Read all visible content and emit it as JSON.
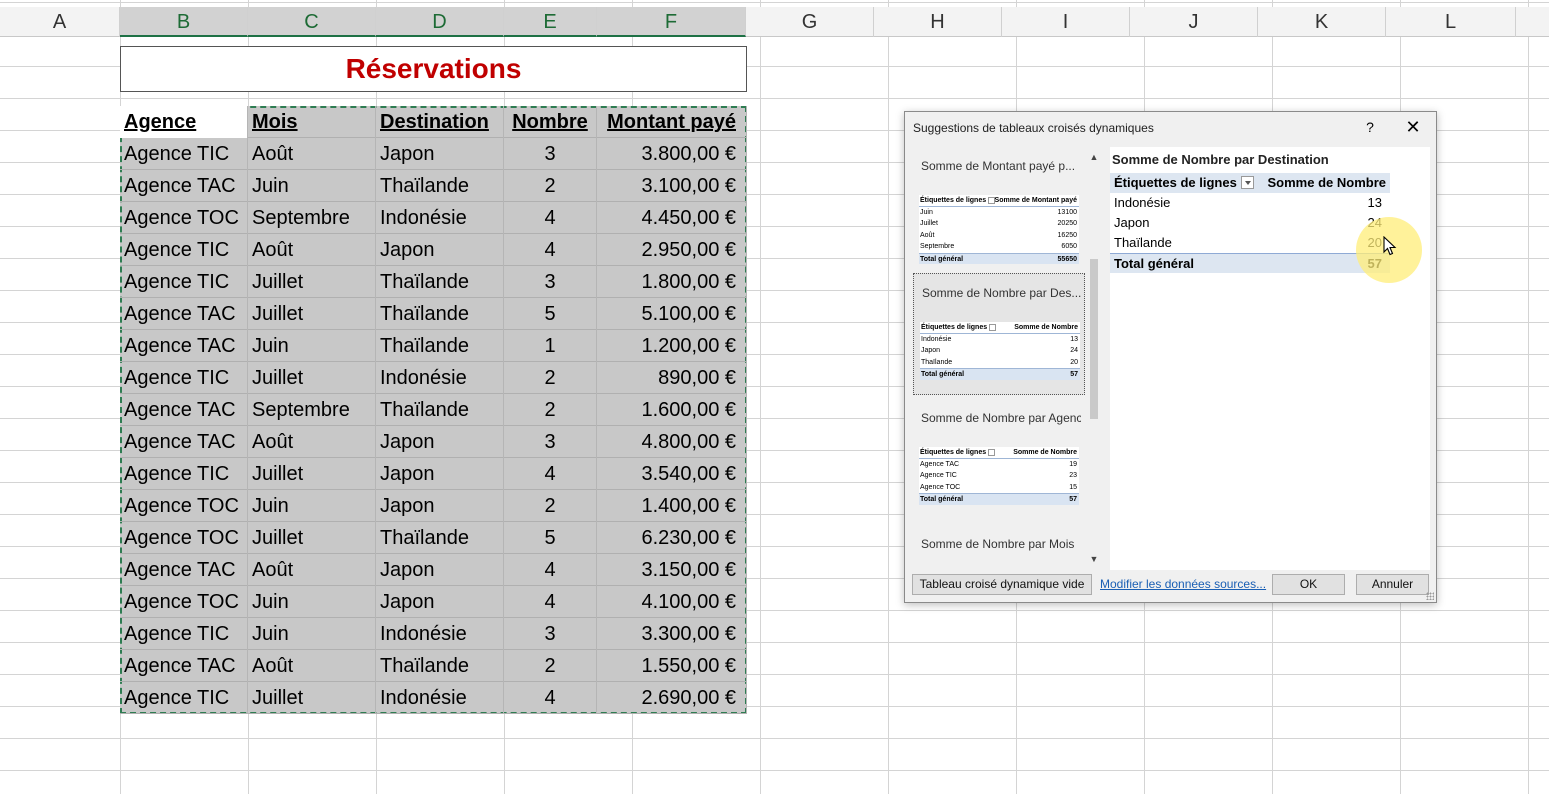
{
  "columns": [
    "A",
    "B",
    "C",
    "D",
    "E",
    "F",
    "G",
    "H",
    "I",
    "J",
    "K",
    "L"
  ],
  "title": "Réservations",
  "table": {
    "headers": [
      "Agence",
      "Mois",
      "Destination",
      "Nombre",
      "Montant payé"
    ],
    "rows": [
      [
        "Agence TIC",
        "Août",
        "Japon",
        "3",
        "3.800,00 €"
      ],
      [
        "Agence TAC",
        "Juin",
        "Thaïlande",
        "2",
        "3.100,00 €"
      ],
      [
        "Agence TOC",
        "Septembre",
        "Indonésie",
        "4",
        "4.450,00 €"
      ],
      [
        "Agence TIC",
        "Août",
        "Japon",
        "4",
        "2.950,00 €"
      ],
      [
        "Agence TIC",
        "Juillet",
        "Thaïlande",
        "3",
        "1.800,00 €"
      ],
      [
        "Agence TAC",
        "Juillet",
        "Thaïlande",
        "5",
        "5.100,00 €"
      ],
      [
        "Agence TAC",
        "Juin",
        "Thaïlande",
        "1",
        "1.200,00 €"
      ],
      [
        "Agence TIC",
        "Juillet",
        "Indonésie",
        "2",
        "890,00 €"
      ],
      [
        "Agence TAC",
        "Septembre",
        "Thaïlande",
        "2",
        "1.600,00 €"
      ],
      [
        "Agence TAC",
        "Août",
        "Japon",
        "3",
        "4.800,00 €"
      ],
      [
        "Agence TIC",
        "Juillet",
        "Japon",
        "4",
        "3.540,00 €"
      ],
      [
        "Agence TOC",
        "Juin",
        "Japon",
        "2",
        "1.400,00 €"
      ],
      [
        "Agence TOC",
        "Juillet",
        "Thaïlande",
        "5",
        "6.230,00 €"
      ],
      [
        "Agence TAC",
        "Août",
        "Japon",
        "4",
        "3.150,00 €"
      ],
      [
        "Agence TOC",
        "Juin",
        "Japon",
        "4",
        "4.100,00 €"
      ],
      [
        "Agence TIC",
        "Juin",
        "Indonésie",
        "3",
        "3.300,00 €"
      ],
      [
        "Agence TAC",
        "Août",
        "Thaïlande",
        "2",
        "1.550,00 €"
      ],
      [
        "Agence TIC",
        "Juillet",
        "Indonésie",
        "4",
        "2.690,00 €"
      ]
    ]
  },
  "dialog": {
    "title": "Suggestions de tableaux croisés dynamiques",
    "help": "?",
    "close": "✕",
    "suggestions": [
      {
        "title": "Somme de Montant payé p...",
        "header": [
          "Étiquettes de lignes",
          "Somme de Montant payé"
        ],
        "rows": [
          [
            "Juin",
            "13100"
          ],
          [
            "Juillet",
            "20250"
          ],
          [
            "Août",
            "16250"
          ],
          [
            "Septembre",
            "6050"
          ]
        ],
        "total": [
          "Total général",
          "55650"
        ]
      },
      {
        "title": "Somme de Nombre par Des...",
        "header": [
          "Étiquettes de lignes",
          "Somme de Nombre"
        ],
        "rows": [
          [
            "Indonésie",
            "13"
          ],
          [
            "Japon",
            "24"
          ],
          [
            "Thaïlande",
            "20"
          ]
        ],
        "total": [
          "Total général",
          "57"
        ]
      },
      {
        "title": "Somme de Nombre par Agence",
        "header": [
          "Étiquettes de lignes",
          "Somme de Nombre"
        ],
        "rows": [
          [
            "Agence TAC",
            "19"
          ],
          [
            "Agence TIC",
            "23"
          ],
          [
            "Agence TOC",
            "15"
          ]
        ],
        "total": [
          "Total général",
          "57"
        ]
      },
      {
        "title": "Somme de Nombre par Mois",
        "header": [],
        "rows": [],
        "total": []
      }
    ],
    "preview": {
      "title": "Somme de Nombre par Destination",
      "header_label": "Étiquettes de lignes",
      "header_value": "Somme de Nombre",
      "rows": [
        [
          "Indonésie",
          "13"
        ],
        [
          "Japon",
          "24"
        ],
        [
          "Thaïlande",
          "20"
        ]
      ],
      "total_label": "Total général",
      "total_value": "57"
    },
    "scroll_up": "▲",
    "scroll_down": "▼",
    "buttons": {
      "blank": "Tableau croisé dynamique vide",
      "modify": "Modifier les données sources...",
      "ok": "OK",
      "cancel": "Annuler"
    }
  }
}
